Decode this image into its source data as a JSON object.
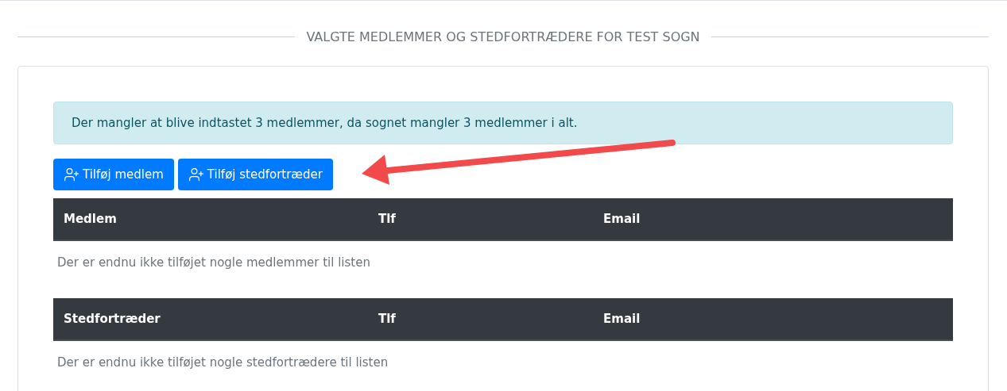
{
  "section_title": "VALGTE MEDLEMMER OG STEDFORTRÆDERE FOR TEST SOGN",
  "alert": "Der mangler at blive indtastet 3 medlemmer, da sognet mangler 3 medlemmer i alt.",
  "buttons": [
    {
      "label": "Tilføj medlem"
    },
    {
      "label": "Tilføj stedfortræder"
    }
  ],
  "tables": [
    {
      "columns": [
        "Medlem",
        "Tlf",
        "Email"
      ],
      "empty_text": "Der er endnu ikke tilføjet nogle medlemmer til listen"
    },
    {
      "columns": [
        "Stedfortræder",
        "Tlf",
        "Email"
      ],
      "empty_text": "Der er endnu ikke tilføjet nogle stedfortrædere til listen"
    }
  ]
}
